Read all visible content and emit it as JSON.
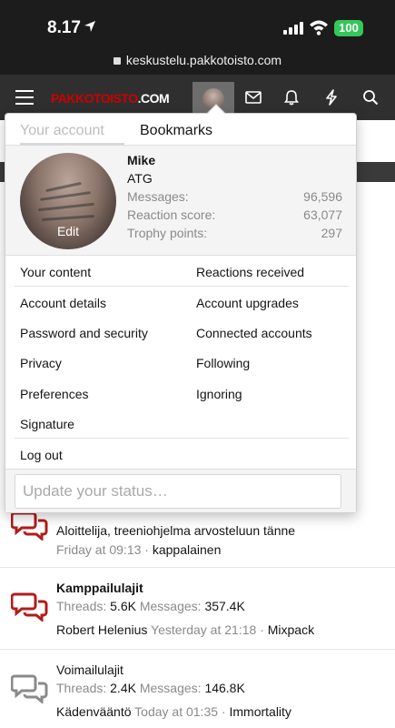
{
  "status_bar": {
    "time": "8.17",
    "battery": "100",
    "url": "keskustelu.pakkotoisto.com"
  },
  "header": {
    "logo_red": "PAKKOTOISTO",
    "logo_white": ".COM"
  },
  "popup": {
    "tabs": [
      "Your account",
      "Bookmarks"
    ],
    "user": {
      "name": "Mike",
      "title": "ATG",
      "edit_label": "Edit"
    },
    "stats": [
      {
        "label": "Messages:",
        "value": "96,596"
      },
      {
        "label": "Reaction score:",
        "value": "63,077"
      },
      {
        "label": "Trophy points:",
        "value": "297"
      }
    ],
    "links": {
      "your_content": "Your content",
      "reactions_received": "Reactions received",
      "account_details": "Account details",
      "account_upgrades": "Account upgrades",
      "password_security": "Password and security",
      "connected_accounts": "Connected accounts",
      "privacy": "Privacy",
      "following": "Following",
      "preferences": "Preferences",
      "ignoring": "Ignoring",
      "signature": "Signature",
      "log_out": "Log out"
    },
    "status_placeholder": "Update your status…"
  },
  "forums": [
    {
      "last_line_title": "Aloittelija, treeniohjelma arvosteluun tänne",
      "last_time": "Friday at 09:13",
      "last_user": "kappalainen",
      "icon_color": "#b31b1b"
    },
    {
      "title": "Kamppailulajit",
      "threads_label": "Threads:",
      "threads": "5.6K",
      "messages_label": "Messages:",
      "messages": "357.4K",
      "last_title": "Robert Helenius",
      "last_time": "Yesterday at 21:18",
      "last_user": "Mixpack",
      "icon_color": "#b31b1b"
    },
    {
      "title": "Voimailulajit",
      "threads_label": "Threads:",
      "threads": "2.4K",
      "messages_label": "Messages:",
      "messages": "146.8K",
      "last_title": "Kädenvääntö",
      "last_time": "Today at 01:35",
      "last_user": "Immortality",
      "icon_color": "#8a8a8a"
    }
  ],
  "separator": "·"
}
